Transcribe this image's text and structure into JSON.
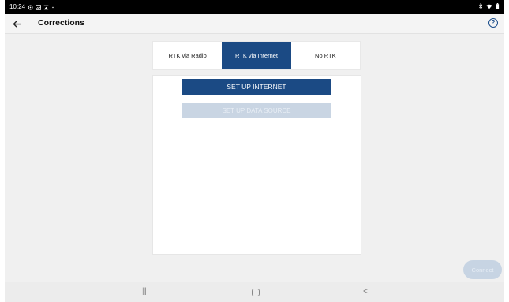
{
  "status_bar": {
    "time": "10:24",
    "left_icons": [
      "settings-icon",
      "image-icon",
      "cast-icon",
      "dot-icon"
    ],
    "right_icons": [
      "bluetooth-icon",
      "wifi-icon",
      "battery-icon"
    ]
  },
  "app_bar": {
    "title": "Corrections",
    "back_icon": "arrow-left-icon",
    "help_icon": "question-circle-icon"
  },
  "tabs": [
    {
      "label": "RTK via Radio",
      "active": false
    },
    {
      "label": "RTK via Internet",
      "active": true
    },
    {
      "label": "No RTK",
      "active": false
    }
  ],
  "panel": {
    "primary_button": "SET UP INTERNET",
    "disabled_button": "SET UP DATA SOURCE"
  },
  "connect_button": "Connect",
  "nav_bar": {
    "recents": "|||",
    "home": "home",
    "back": "<"
  },
  "colors": {
    "accent": "#1b4a84",
    "disabled": "#c9d5e3",
    "background": "#f0f0f0"
  }
}
